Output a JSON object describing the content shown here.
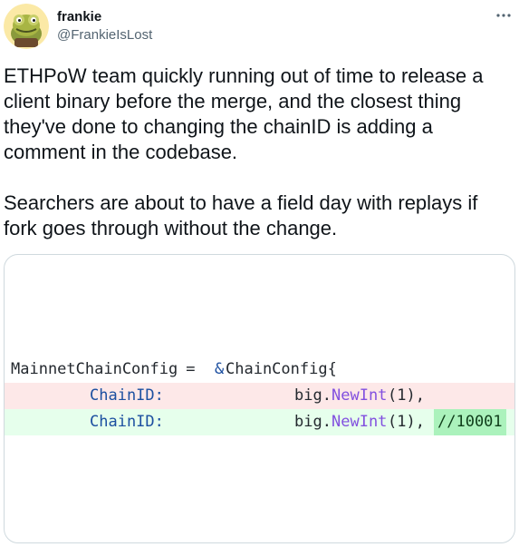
{
  "user": {
    "name": "frankie",
    "handle": "@FrankieIsLost",
    "avatar_icon": "frog-avatar-icon"
  },
  "more_icon": "more-dots-icon",
  "tweet_text": "ETHPoW team quickly running out of time to release a client binary before the merge, and the closest thing they've done to changing the chainID is adding a comment in the codebase.\n\nSearchers are about to have a field day with replays if fork goes through without the change.",
  "code": {
    "line1": {
      "var": "MainnetChainConfig",
      "op": " = ",
      "amp": "&",
      "type": "ChainConfig{"
    },
    "removed": {
      "key": "ChainID:",
      "obj": "big.",
      "fn": "NewInt",
      "arg": "(1),"
    },
    "added": {
      "key": "ChainID:",
      "obj": "big.",
      "fn": "NewInt",
      "arg": "(1),",
      "comment": "//10001"
    }
  },
  "colors": {
    "removed_bg": "#fde8e8",
    "added_bg": "#e6ffec",
    "comment_highlight": "#abf2bc"
  }
}
